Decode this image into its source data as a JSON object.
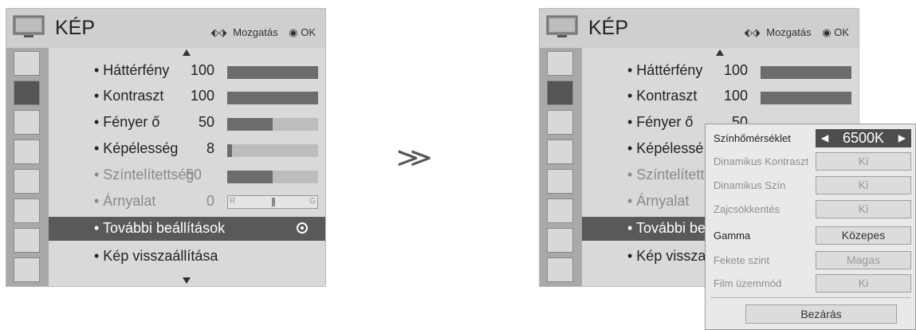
{
  "menu": {
    "title": "KÉP",
    "help_move": "Mozgatás",
    "help_ok": "OK"
  },
  "side_icons": [
    "cable-icon",
    "picture-icon",
    "audio-icon",
    "clock-icon",
    "option-icon",
    "lock-icon",
    "input-icon",
    "photo-icon"
  ],
  "items": [
    {
      "label": "• Háttérfény",
      "value": "100",
      "level": 1.0,
      "dim": false
    },
    {
      "label": "• Kontraszt",
      "value": "100",
      "level": 1.0,
      "dim": false
    },
    {
      "label": "• Fényer ő",
      "value": "50",
      "level": 0.5,
      "dim": false
    },
    {
      "label": "• Képélesség",
      "value": "8",
      "level": 0.05,
      "dim": false
    },
    {
      "label": "• Színtelítettség",
      "value": "50",
      "level": 0.5,
      "dim": true
    },
    {
      "label": "• Árnyalat",
      "value": "0",
      "tint_r": "R",
      "tint_g": "G",
      "dim": true
    },
    {
      "label": "• További beállítások",
      "highlighted": true
    },
    {
      "label": "• Kép visszaállítása"
    }
  ],
  "right_items_cut": {
    "kepeless": "• Képélessé",
    "szintel": "• Színtelítetts",
    "tovabbi": "• További be",
    "kep_vissza": "• Kép vissza",
    "fenyero_val": "50"
  },
  "arrow": "≫",
  "popup": {
    "rows": [
      {
        "label": "Színhőmérséklet",
        "value": "6500K",
        "selected": true
      },
      {
        "label": "Dinamikus Kontraszt",
        "value": "Ki",
        "dim": true
      },
      {
        "label": "Dinamikus Szín",
        "value": "Ki",
        "dim": true
      },
      {
        "label": "Zajcsökkentés",
        "value": "Ki",
        "dim": true
      },
      {
        "label": "Gamma",
        "value": "Közepes",
        "dim": false
      },
      {
        "label": "Fekete szint",
        "value": "Magas",
        "dim": true
      },
      {
        "label": "Film üzemmód",
        "value": "Ki",
        "dim": true
      }
    ],
    "close": "Bezárás"
  }
}
